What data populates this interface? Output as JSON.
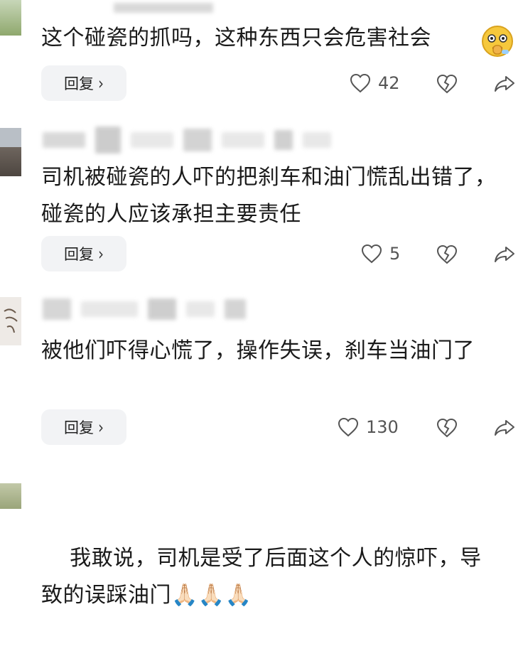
{
  "comments": [
    {
      "text": "这个碰瓷的抓吗，这种东西只会危害社会",
      "reply_label": "回复",
      "like_count": "42"
    },
    {
      "text": "司机被碰瓷的人吓的把刹车和油门慌乱出错了，碰瓷的人应该承担主要责任",
      "reply_label": "回复",
      "like_count": "5"
    },
    {
      "text": "被他们吓得心慌了，操作失误，刹车当油门了",
      "reply_label": "回复",
      "like_count": "130"
    },
    {
      "text": "我敢说，司机是受了后面这个人的惊吓，导致的误踩油门",
      "emoji": "🙏🏻🙏🏻🙏🏻"
    }
  ],
  "icons": {
    "like": "heart-outline-icon",
    "dislike": "broken-heart-icon",
    "share": "share-arrow-icon",
    "reply_chevron": "chevron-right-icon",
    "emoji_1": "shushing-face-emoji"
  }
}
